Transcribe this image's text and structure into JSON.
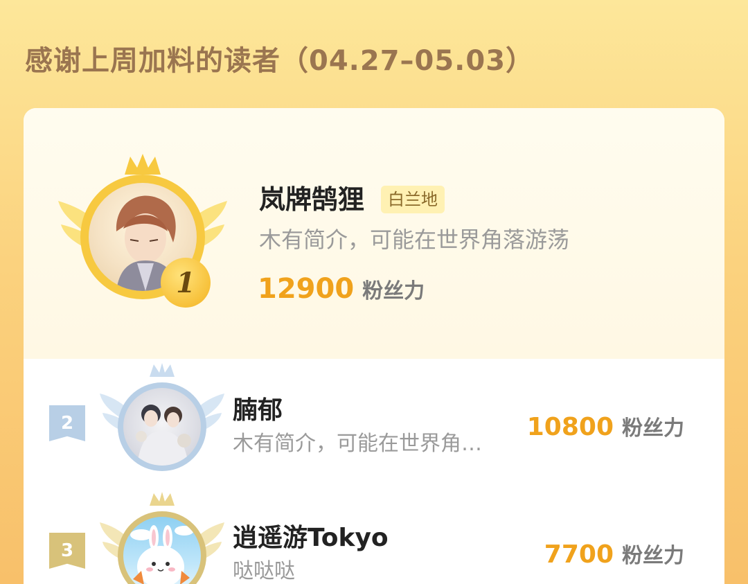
{
  "title": "感谢上周加料的读者（04.27–05.03）",
  "ranking": [
    {
      "rank": "1",
      "name": "岚牌鹄狸",
      "tag": "白兰地",
      "bio": "木有简介，可能在世界角落游荡",
      "score": "12900",
      "unit": "粉丝力"
    },
    {
      "rank": "2",
      "name": "腩郁",
      "bio": "木有简介，可能在世界角…",
      "score": "10800",
      "unit": "粉丝力"
    },
    {
      "rank": "3",
      "name": "逍遥游Tokyo",
      "bio": "哒哒哒",
      "score": "7700",
      "unit": "粉丝力"
    }
  ],
  "colors": {
    "accent": "#f0a21c",
    "gold": "#f7c940",
    "silver": "#b8cfe6",
    "bronze": "#d8c27a"
  }
}
